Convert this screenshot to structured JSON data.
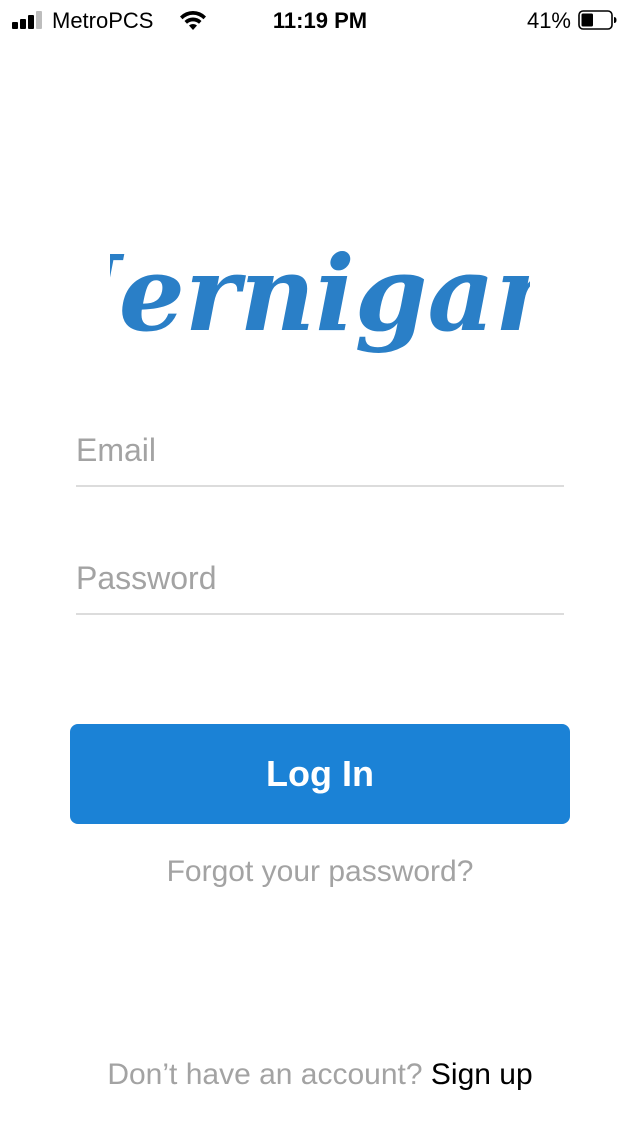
{
  "status_bar": {
    "carrier": "MetroPCS",
    "time": "11:19 PM",
    "battery_percent": "41%",
    "battery_level": 0.41,
    "signal_bars": 3,
    "signal_total": 4
  },
  "logo": {
    "text": "Jernigan",
    "color": "#2a7fc7"
  },
  "form": {
    "email": {
      "placeholder": "Email",
      "value": ""
    },
    "password": {
      "placeholder": "Password",
      "value": ""
    },
    "login_label": "Log In",
    "forgot_label": "Forgot your password?"
  },
  "footer": {
    "prompt": "Don’t have an account?",
    "signup_label": "Sign up"
  },
  "colors": {
    "accent": "#1b82d6",
    "muted_text": "#a3a3a3",
    "divider": "#dcdcdc"
  }
}
